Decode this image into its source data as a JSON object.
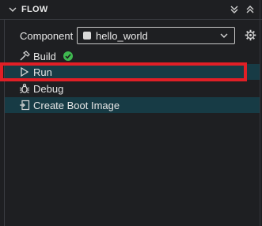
{
  "header": {
    "title": "FLOW"
  },
  "component": {
    "label": "Component",
    "selected": "hello_world"
  },
  "items": [
    {
      "label": "Build",
      "icon": "hammer-icon",
      "status": "success"
    },
    {
      "label": "Run",
      "icon": "play-icon"
    },
    {
      "label": "Debug",
      "icon": "bug-icon"
    },
    {
      "label": "Create Boot Image",
      "icon": "boot-image-icon"
    }
  ],
  "colors": {
    "background": "#1e1f22",
    "highlight": "#173b45",
    "annotation": "#e01f26",
    "success": "#3fb950"
  }
}
